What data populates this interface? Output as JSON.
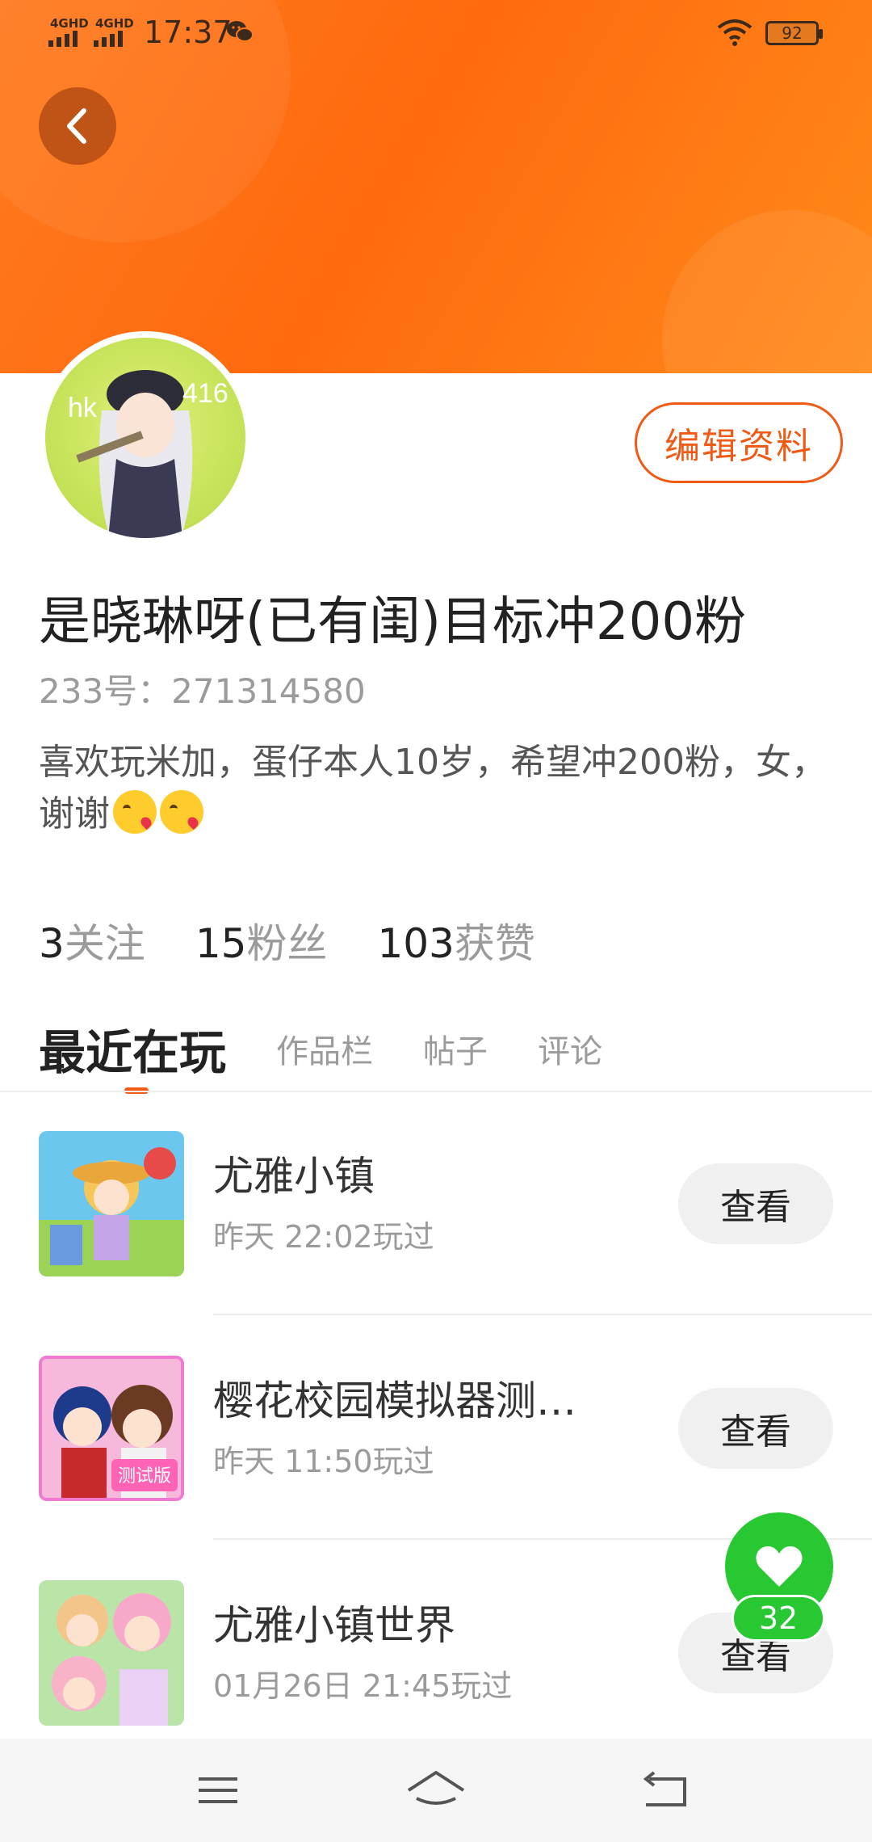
{
  "status_bar": {
    "sim1": "4GHD",
    "sim2": "4GHD",
    "time": "17:37",
    "battery": "92"
  },
  "profile": {
    "edit_label": "编辑资料",
    "name": "是晓琳呀(已有闺)目标冲200粉",
    "uid": "233号：271314580",
    "bio": "喜欢玩米加，蛋仔本人10岁，希望冲200粉，女，谢谢",
    "stats": [
      {
        "num": "3",
        "label": "关注"
      },
      {
        "num": "15",
        "label": "粉丝"
      },
      {
        "num": "103",
        "label": "获赞"
      }
    ]
  },
  "tabs": [
    "最近在玩",
    "作品栏",
    "帖子",
    "评论"
  ],
  "games": [
    {
      "title": "尤雅小镇",
      "played": "昨天 22:02玩过",
      "button": "查看"
    },
    {
      "title": "樱花校园模拟器测…",
      "played": "昨天 11:50玩过",
      "button": "查看",
      "badge": "测试版"
    },
    {
      "title": "尤雅小镇世界",
      "played": "01月26日 21:45玩过",
      "button": "查看"
    }
  ],
  "like": {
    "count": "32"
  },
  "colors": {
    "accent": "#f05a14",
    "banner": "#ff7a1f",
    "like": "#27c832"
  }
}
